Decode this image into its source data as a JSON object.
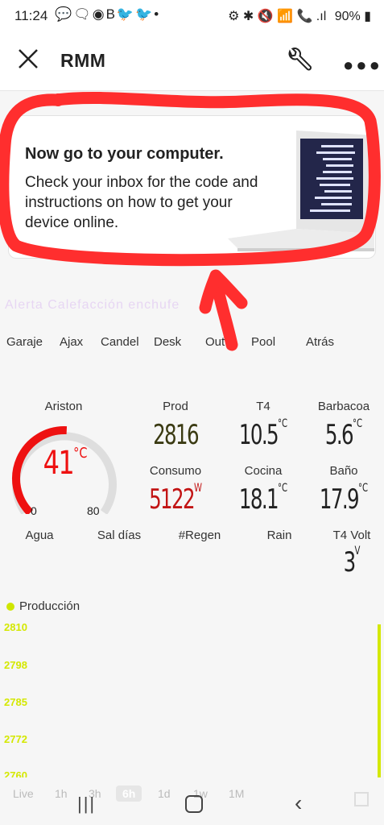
{
  "status_bar": {
    "time": "11:24",
    "notif_icons": "💬🗨◉B🐦🐦•",
    "system_icons": "⚙ ✱ 🔇 📶 📞 .ıl",
    "battery": "90%"
  },
  "app_bar": {
    "title": "RMM"
  },
  "card": {
    "heading": "Now go to your computer.",
    "body": "Check your inbox for the code and instructions on how to get your device online."
  },
  "background_text": "Alerta Calefacción enchufe",
  "tabs": [
    "Garaje",
    "Ajax",
    "Candel",
    "Desk",
    "Out",
    "Pool",
    "Atrás"
  ],
  "gauge": {
    "label": "Ariston",
    "value": "41",
    "unit": "°C",
    "min": "0",
    "max": "80",
    "level": 0.51
  },
  "tiles": {
    "prod": {
      "label": "Prod",
      "value": "2816",
      "unit": ""
    },
    "t4": {
      "label": "T4",
      "value": "10.5",
      "unit": "°C"
    },
    "barbacoa": {
      "label": "Barbacoa",
      "value": "5.6",
      "unit": "°C"
    },
    "consumo": {
      "label": "Consumo",
      "value": "5122",
      "unit": "W"
    },
    "cocina": {
      "label": "Cocina",
      "value": "18.1",
      "unit": "°C"
    },
    "bano": {
      "label": "Baño",
      "value": "17.9",
      "unit": "°C"
    },
    "agua": {
      "label": "Agua"
    },
    "sal_dias": {
      "label": "Sal días"
    },
    "regen": {
      "label": "#Regen"
    },
    "rain": {
      "label": "Rain"
    },
    "t4volt": {
      "label": "T4 Volt",
      "value": "3",
      "unit": "V"
    }
  },
  "colors": {
    "accent_red": "#e11",
    "prod_green": "#3a3a12",
    "series": "#d4e800",
    "annotation": "#ff2e2e"
  },
  "chart_data": {
    "type": "line",
    "legend": "Producción",
    "y_ticks": [
      "2810",
      "2798",
      "2785",
      "2772",
      "2760"
    ],
    "ylim": [
      2760,
      2810
    ],
    "series": [
      {
        "name": "Producción",
        "values": [
          2760,
          2816
        ]
      }
    ]
  },
  "time_ranges": [
    "Live",
    "1h",
    "3h",
    "6h",
    "1d",
    "1w",
    "1M"
  ],
  "time_range_active": "6h"
}
